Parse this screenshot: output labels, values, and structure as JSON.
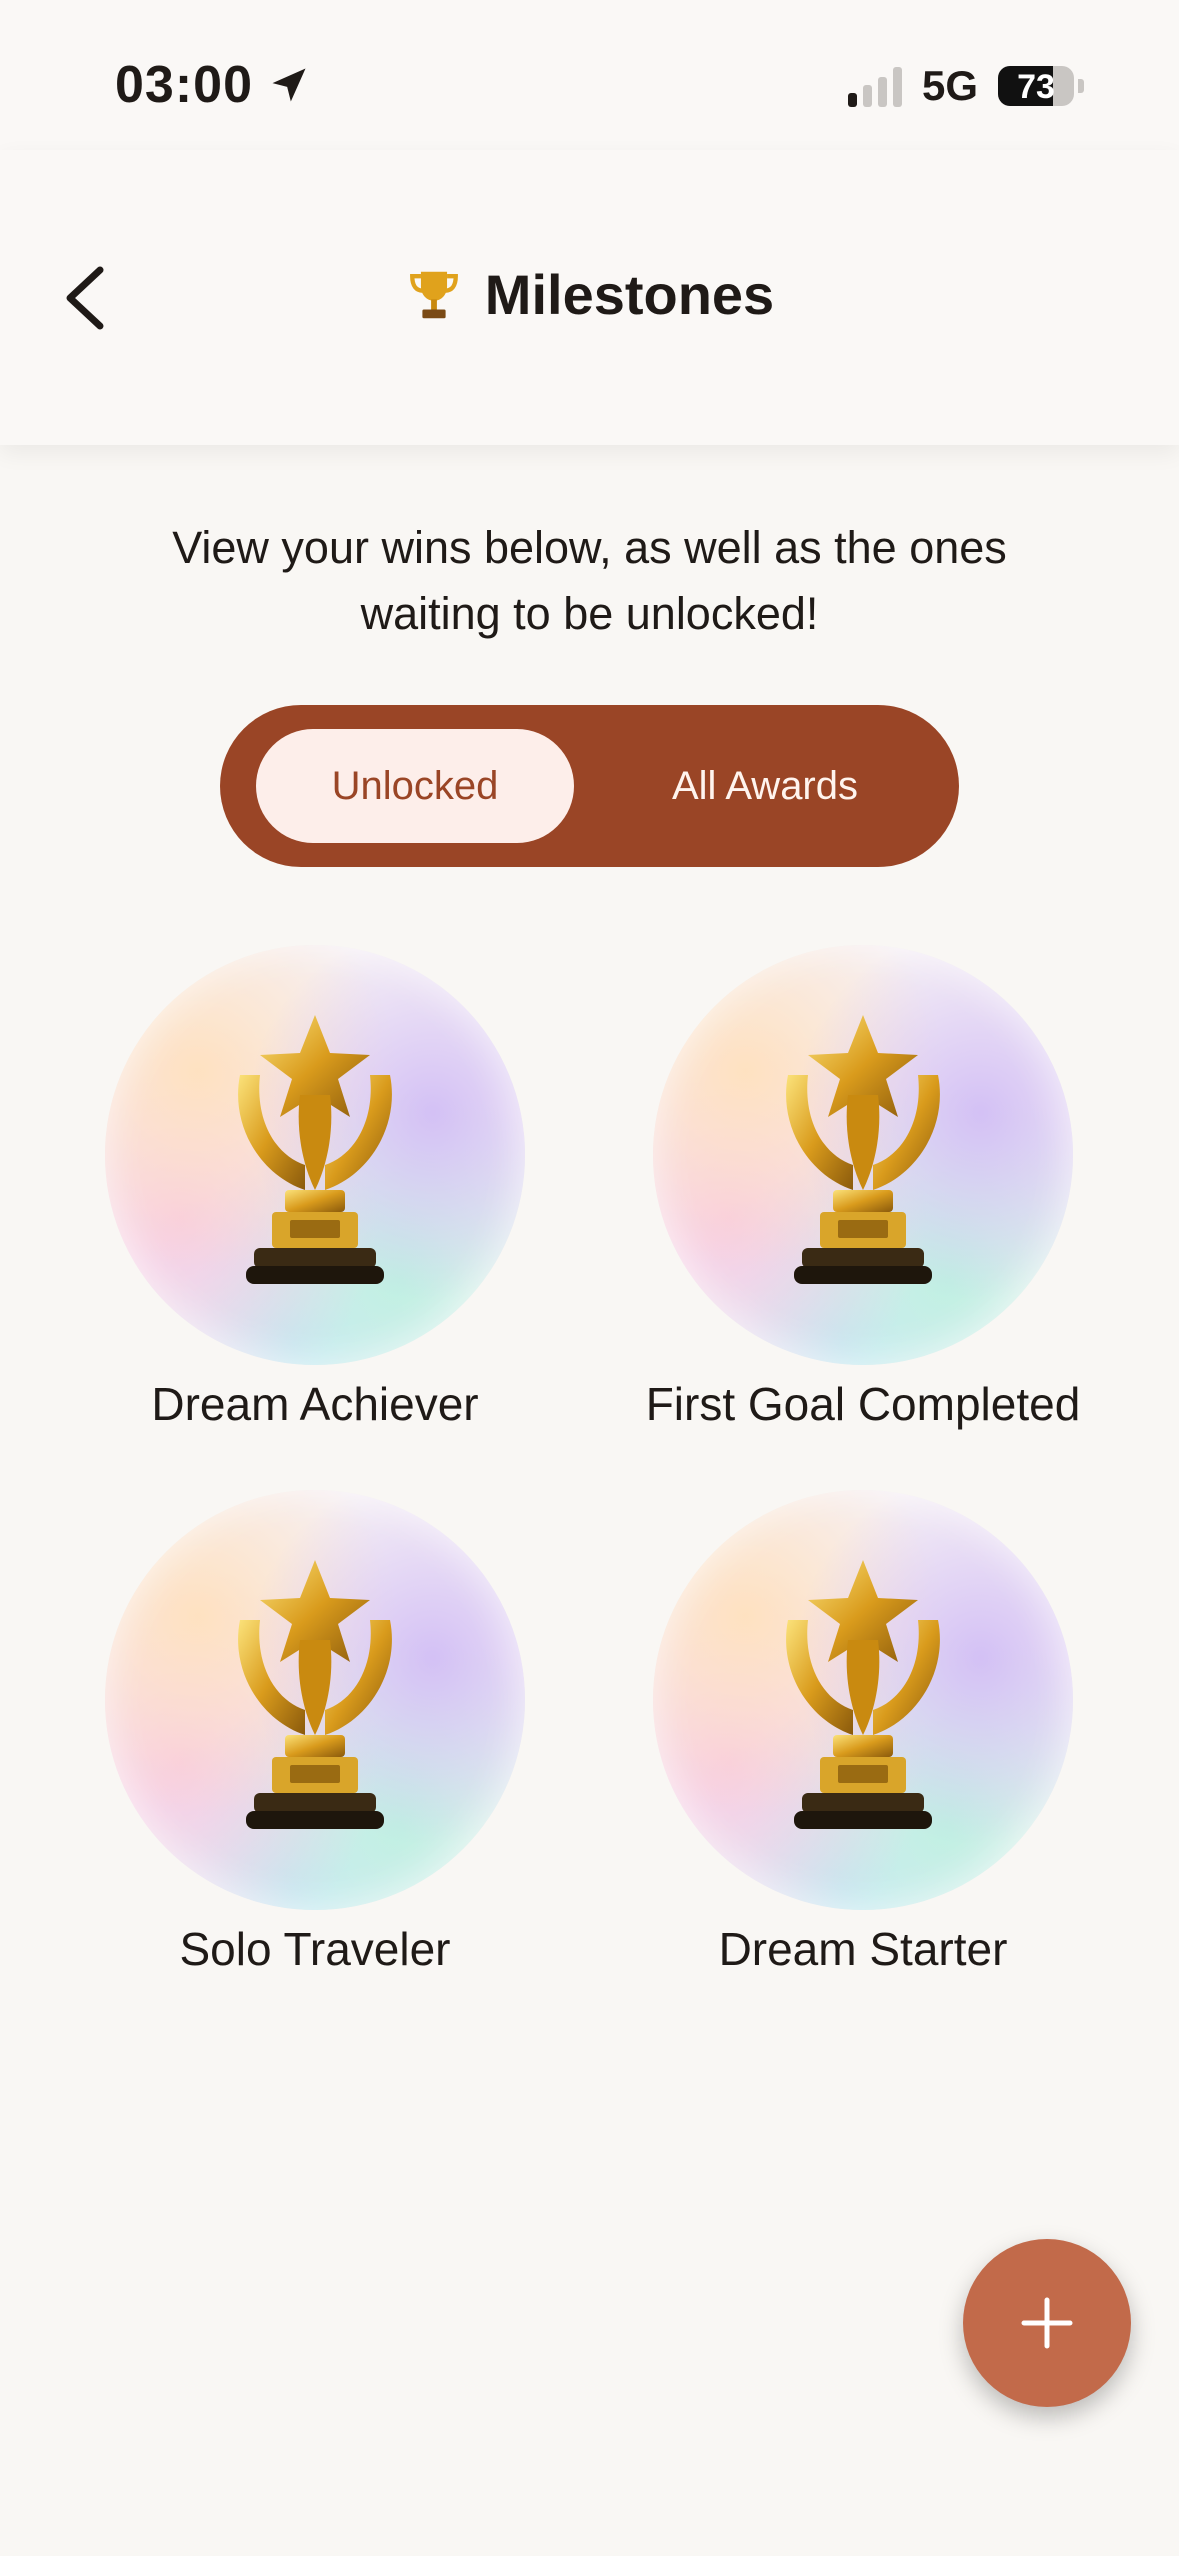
{
  "status_bar": {
    "time": "03:00",
    "network": "5G",
    "battery": "73"
  },
  "header": {
    "title": "Milestones",
    "title_icon": "trophy-icon",
    "back_icon": "chevron-left-icon"
  },
  "intro_text": "View your wins below, as well as the ones waiting to be unlocked!",
  "tabs": [
    {
      "label": "Unlocked",
      "selected": true
    },
    {
      "label": "All Awards",
      "selected": false
    }
  ],
  "awards": [
    {
      "label": "Dream Achiever",
      "icon": "trophy-icon"
    },
    {
      "label": "First Goal Completed",
      "icon": "trophy-icon"
    },
    {
      "label": "Solo Traveler",
      "icon": "trophy-icon"
    },
    {
      "label": "Dream Starter",
      "icon": "trophy-icon"
    }
  ],
  "fab": {
    "icon": "plus-icon"
  },
  "colors": {
    "accent": "#9a4526",
    "tab_active_bg": "#fdeeea",
    "fab": "#c26a4a",
    "background": "#f9f7f4"
  }
}
